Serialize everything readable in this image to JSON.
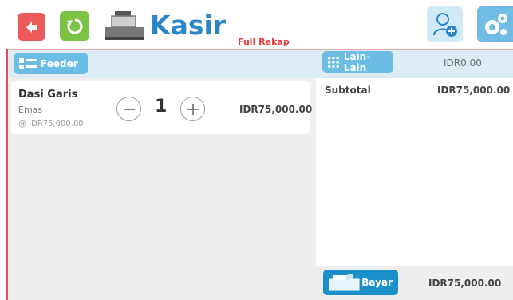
{
  "header": {
    "title": "Kasir",
    "mode_label": "Full Rekap"
  },
  "toolbar": {
    "back_icon": "arrow-left-icon",
    "refresh_icon": "refresh-icon",
    "logo_icon": "cash-register-icon",
    "add_user_icon": "add-user-icon",
    "settings_icon": "gears-icon",
    "colors": {
      "back": "#ee5a5a",
      "refresh": "#7cc244",
      "title": "#2b86c6",
      "accent": "#6cbde5"
    }
  },
  "left_panel": {
    "feeder_label": "Feeder"
  },
  "right_panel": {
    "lain_label": "Lain-Lain",
    "lain_total": "IDR0.00"
  },
  "cart": {
    "items": [
      {
        "name": "Dasi Garis",
        "variant": "Emas",
        "unit_price": "@ IDR75,000.00",
        "quantity": "1",
        "total": "IDR75,000.00"
      }
    ]
  },
  "summary": {
    "subtotal_label": "Subtotal",
    "subtotal_value": "IDR75,000.00"
  },
  "payment": {
    "pay_label": "Bayar",
    "pay_total": "IDR75,000.00"
  }
}
